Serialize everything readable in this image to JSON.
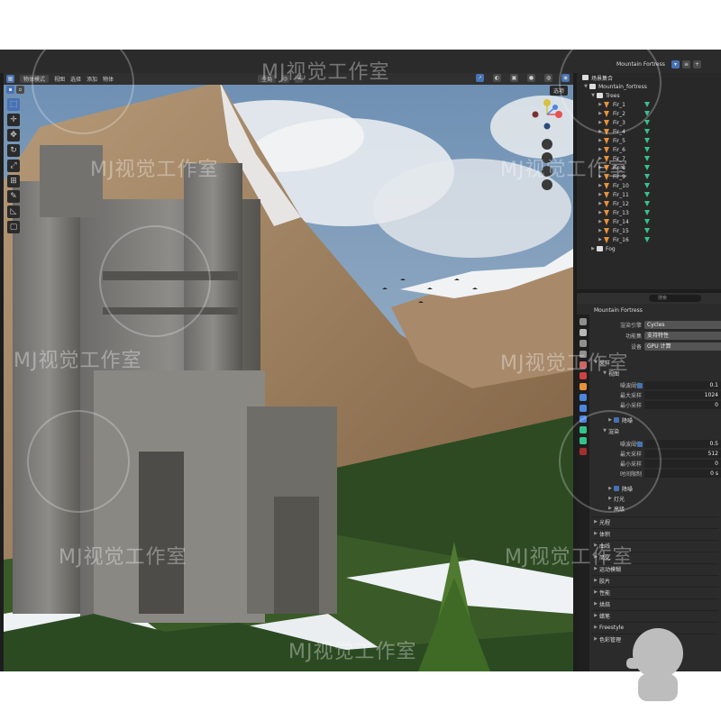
{
  "top_bar": {
    "scene_name": "Mountain Fortress"
  },
  "viewport": {
    "mode_label": "物体模式",
    "menu": [
      "视图",
      "选择",
      "添加",
      "物体"
    ],
    "transform_orientation": "全局",
    "options_label": "选项",
    "tools": [
      "select-box",
      "cursor",
      "move",
      "rotate",
      "scale",
      "transform",
      "annotate",
      "measure",
      "add-cube"
    ]
  },
  "outliner": {
    "scene_collection": "场景集合",
    "collection": "Mountain_fortress",
    "trees_collection": "Trees",
    "trees": [
      "Fir_1",
      "Fir_2",
      "Fir_3",
      "Fir_4",
      "Fir_5",
      "Fir_6",
      "Fir_7",
      "Fir_8",
      "Fir_9",
      "Fir_10",
      "Fir_11",
      "Fir_12",
      "Fir_13",
      "Fir_14",
      "Fir_15",
      "Fir_16"
    ],
    "fog": "Fog"
  },
  "properties": {
    "search_placeholder": "搜索",
    "scene_name": "Mountain Fortress",
    "render_engine_label": "渲染引擎",
    "render_engine": "Cycles",
    "feature_set_label": "功能集",
    "feature_set": "支持特性",
    "device_label": "设备",
    "device": "GPU 计算",
    "sampling": "采样",
    "viewport_sub": "视图",
    "noise_threshold_label": "噪波阈值",
    "viewport_noise_threshold": "0.1",
    "max_samples_label": "最大采样",
    "viewport_max_samples": "1024",
    "min_samples_label": "最小采样",
    "viewport_min_samples": "0",
    "denoise_label": "降噪",
    "render_sub": "渲染",
    "render_noise_threshold": "0.5",
    "render_max_samples": "512",
    "render_min_samples": "0",
    "time_limit_label": "时间限制",
    "render_time_limit": "0 s",
    "render_denoise": "降噪",
    "lights_sub": "灯光",
    "advanced_sub": "高级",
    "panels": [
      "光程",
      "体积",
      "曲线",
      "简化",
      "运动模糊",
      "胶片",
      "性能",
      "烘焙",
      "蜡笔",
      "Freestyle",
      "色彩管理"
    ]
  },
  "watermark": {
    "text": "MJ视觉工作室",
    "logo": "25"
  },
  "colors": {
    "accent": "#4772b3",
    "tree_icon": "#e8913a",
    "visibility": "#35c28b"
  }
}
